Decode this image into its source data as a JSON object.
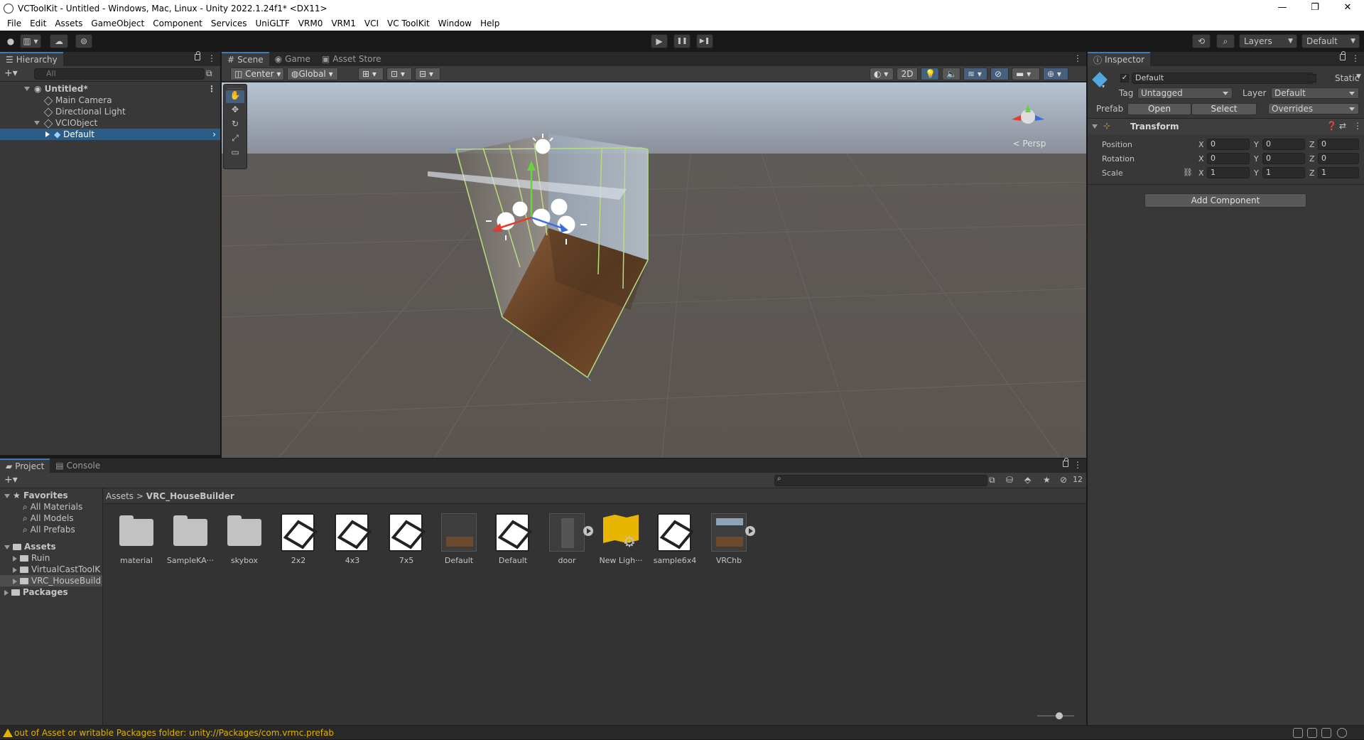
{
  "window": {
    "title": "VCToolKit - Untitled - Windows, Mac, Linux - Unity 2022.1.24f1* <DX11>",
    "controls": [
      "—",
      "❐",
      "✕"
    ]
  },
  "menu": [
    "File",
    "Edit",
    "Assets",
    "GameObject",
    "Component",
    "Services",
    "UniGLTF",
    "VRM0",
    "VRM1",
    "VCI",
    "VC ToolKit",
    "Window",
    "Help"
  ],
  "toolbar": {
    "play": "▶",
    "pause": "❚❚",
    "step": "▶❚",
    "layers": "Layers",
    "layout": "Default"
  },
  "hierarchy": {
    "tab": "Hierarchy",
    "search_placeholder": "All",
    "items": [
      {
        "label": "Untitled*"
      },
      {
        "label": "Main Camera"
      },
      {
        "label": "Directional Light"
      },
      {
        "label": "VCIObject"
      },
      {
        "label": "Default"
      }
    ]
  },
  "scene": {
    "tabs": [
      "Scene",
      "Game",
      "Asset Store"
    ],
    "pivot": "Center",
    "space": "Global",
    "mode_2d": "2D",
    "persp": "< Persp"
  },
  "inspector": {
    "tab": "Inspector",
    "object_name": "Default",
    "static_label": "Static",
    "tag_label": "Tag",
    "tag_value": "Untagged",
    "layer_label": "Layer",
    "layer_value": "Default",
    "prefab_label": "Prefab",
    "open_btn": "Open",
    "select_btn": "Select",
    "overrides": "Overrides",
    "transform": {
      "title": "Transform",
      "rows": [
        {
          "label": "Position",
          "x": "0",
          "y": "0",
          "z": "0"
        },
        {
          "label": "Rotation",
          "x": "0",
          "y": "0",
          "z": "0"
        },
        {
          "label": "Scale",
          "x": "1",
          "y": "1",
          "z": "1"
        }
      ],
      "axis_x": "X",
      "axis_y": "Y",
      "axis_z": "Z"
    },
    "add_component": "Add Component"
  },
  "project": {
    "tabs": [
      "Project",
      "Console"
    ],
    "hidden_count": "12",
    "tree": [
      {
        "label": "Favorites"
      },
      {
        "label": "All Materials"
      },
      {
        "label": "All Models"
      },
      {
        "label": "All Prefabs"
      },
      {
        "label": "Assets"
      },
      {
        "label": "Ruin"
      },
      {
        "label": "VirtualCastToolK"
      },
      {
        "label": "VRC_HouseBuild"
      },
      {
        "label": "Packages"
      }
    ],
    "breadcrumb_root": "Assets",
    "breadcrumb_sep": ">",
    "breadcrumb_current": "VRC_HouseBuilder",
    "assets": [
      {
        "name": "material"
      },
      {
        "name": "SampleKA···"
      },
      {
        "name": "skybox"
      },
      {
        "name": "2x2"
      },
      {
        "name": "4x3"
      },
      {
        "name": "7x5"
      },
      {
        "name": "Default"
      },
      {
        "name": "Default"
      },
      {
        "name": "door"
      },
      {
        "name": "New Ligh···"
      },
      {
        "name": "sample6x4"
      },
      {
        "name": "VRChb"
      }
    ]
  },
  "status": {
    "message": "out of Asset or writable Packages folder: unity://Packages/com.vrmc.prefab"
  },
  "colors": {
    "accent": "#3a79bb",
    "selection": "#2c5d87",
    "warning": "#e0b100"
  }
}
